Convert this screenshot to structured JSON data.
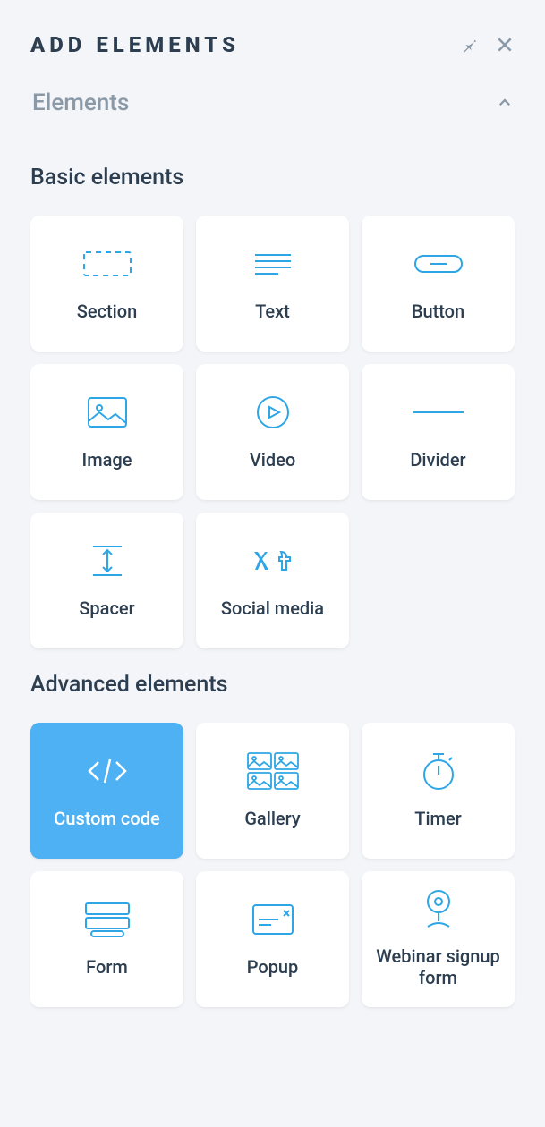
{
  "panel": {
    "title": "ADD ELEMENTS",
    "section_header": "Elements"
  },
  "groups": [
    {
      "title": "Basic elements",
      "items": [
        {
          "id": "section",
          "label": "Section",
          "active": false
        },
        {
          "id": "text",
          "label": "Text",
          "active": false
        },
        {
          "id": "button",
          "label": "Button",
          "active": false
        },
        {
          "id": "image",
          "label": "Image",
          "active": false
        },
        {
          "id": "video",
          "label": "Video",
          "active": false
        },
        {
          "id": "divider",
          "label": "Divider",
          "active": false
        },
        {
          "id": "spacer",
          "label": "Spacer",
          "active": false
        },
        {
          "id": "social-media",
          "label": "Social media",
          "active": false
        }
      ]
    },
    {
      "title": "Advanced elements",
      "items": [
        {
          "id": "custom-code",
          "label": "Custom code",
          "active": true
        },
        {
          "id": "gallery",
          "label": "Gallery",
          "active": false
        },
        {
          "id": "timer",
          "label": "Timer",
          "active": false
        },
        {
          "id": "form",
          "label": "Form",
          "active": false
        },
        {
          "id": "popup",
          "label": "Popup",
          "active": false
        },
        {
          "id": "webinar",
          "label": "Webinar signup form",
          "active": false
        }
      ]
    }
  ]
}
